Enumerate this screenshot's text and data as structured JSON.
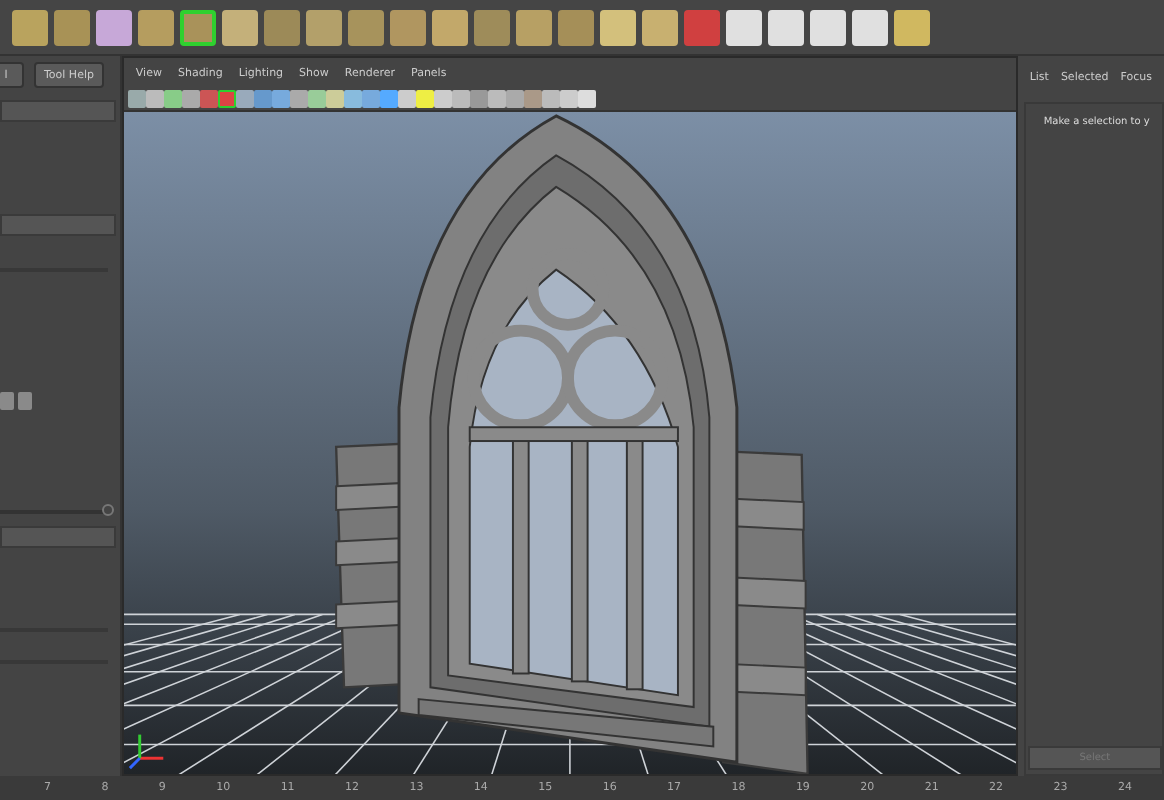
{
  "shelf_tools": [
    {
      "selected": false
    },
    {
      "selected": false
    },
    {
      "selected": false
    },
    {
      "selected": false
    },
    {
      "selected": true
    },
    {
      "selected": false
    },
    {
      "selected": false
    },
    {
      "selected": false
    },
    {
      "selected": false
    },
    {
      "selected": false
    },
    {
      "selected": false
    },
    {
      "selected": false
    },
    {
      "selected": false
    },
    {
      "selected": false
    },
    {
      "selected": false
    },
    {
      "selected": false
    },
    {
      "selected": false
    },
    {
      "selected": false
    },
    {
      "selected": false
    },
    {
      "selected": false
    },
    {
      "selected": false
    },
    {
      "selected": false
    }
  ],
  "tool_settings": {
    "buttons": [
      "l",
      "Tool Help"
    ]
  },
  "viewport": {
    "menu": [
      "View",
      "Shading",
      "Lighting",
      "Show",
      "Renderer",
      "Panels"
    ],
    "toolbar": [
      {
        "selected": false
      },
      {
        "selected": false
      },
      {
        "selected": false
      },
      {
        "selected": false
      },
      {
        "selected": false
      },
      {
        "selected": true
      },
      {
        "selected": false
      },
      {
        "selected": false
      },
      {
        "selected": false
      },
      {
        "selected": false
      },
      {
        "selected": false
      },
      {
        "selected": false
      },
      {
        "selected": false
      },
      {
        "selected": false
      },
      {
        "selected": false
      },
      {
        "selected": false
      },
      {
        "selected": false
      },
      {
        "selected": false
      },
      {
        "selected": false
      },
      {
        "selected": false
      },
      {
        "selected": false
      },
      {
        "selected": false
      },
      {
        "selected": false
      },
      {
        "selected": false
      },
      {
        "selected": false
      },
      {
        "selected": false
      }
    ]
  },
  "attribute_panel": {
    "tabs": [
      "List",
      "Selected",
      "Focus"
    ],
    "message": "Make a selection to y",
    "button": {
      "label": "Select",
      "disabled": true
    }
  },
  "time_slider": {
    "ticks": [
      "7",
      "8",
      "9",
      "10",
      "11",
      "12",
      "13",
      "14",
      "15",
      "16",
      "17",
      "18",
      "19",
      "20",
      "21",
      "22",
      "23",
      "24"
    ]
  }
}
